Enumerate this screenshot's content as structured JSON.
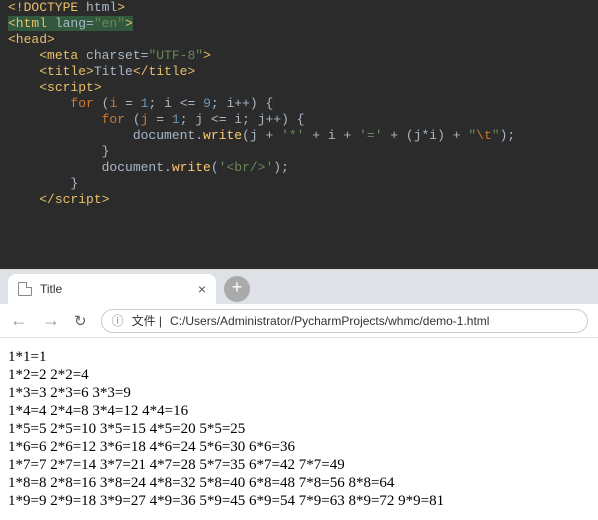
{
  "editor": {
    "lines": [
      [
        [
          "tag",
          "<!DOCTYPE "
        ],
        [
          "attr-name",
          "html"
        ],
        [
          "tag",
          ">"
        ]
      ],
      [
        [
          "html-highlight-open",
          ""
        ],
        [
          "tag",
          "<html "
        ],
        [
          "attr-name",
          "lang="
        ],
        [
          "attr-val",
          "\"en\""
        ],
        [
          "tag",
          ">"
        ],
        [
          "html-highlight-close",
          ""
        ]
      ],
      [
        [
          "tag",
          "<head>"
        ]
      ],
      [
        [
          "indent",
          "    "
        ],
        [
          "tag",
          "<meta "
        ],
        [
          "attr-name",
          "charset="
        ],
        [
          "attr-val",
          "\"UTF-8\""
        ],
        [
          "tag",
          ">"
        ]
      ],
      [
        [
          "indent",
          "    "
        ],
        [
          "tag",
          "<title>"
        ],
        [
          "punct",
          "Title"
        ],
        [
          "tag",
          "</title>"
        ]
      ],
      [
        [
          "indent",
          "    "
        ],
        [
          "tag",
          "<script>"
        ]
      ],
      [
        [
          "indent",
          "        "
        ],
        [
          "kw",
          "for "
        ],
        [
          "punct",
          "("
        ],
        [
          "kw",
          "i"
        ],
        [
          "punct",
          " = "
        ],
        [
          "num",
          "1"
        ],
        [
          "punct",
          "; i <= "
        ],
        [
          "num",
          "9"
        ],
        [
          "punct",
          "; i++) {"
        ]
      ],
      [
        [
          "indent",
          "            "
        ],
        [
          "kw",
          "for "
        ],
        [
          "punct",
          "("
        ],
        [
          "kw",
          "j"
        ],
        [
          "punct",
          " = "
        ],
        [
          "num",
          "1"
        ],
        [
          "punct",
          "; j <= i; j++) {"
        ]
      ],
      [
        [
          "indent",
          "                "
        ],
        [
          "punct",
          "document."
        ],
        [
          "fn",
          "write"
        ],
        [
          "punct",
          "(j + "
        ],
        [
          "str",
          "'*'"
        ],
        [
          "punct",
          " + i + "
        ],
        [
          "str",
          "'='"
        ],
        [
          "punct",
          " + (j*i) + "
        ],
        [
          "str",
          "\""
        ],
        [
          "escape",
          "\\t"
        ],
        [
          "str",
          "\""
        ],
        [
          "punct",
          ");"
        ]
      ],
      [
        [
          "indent",
          "            "
        ],
        [
          "punct",
          "}"
        ]
      ],
      [
        [
          "indent",
          "            "
        ],
        [
          "punct",
          "document."
        ],
        [
          "fn",
          "write"
        ],
        [
          "punct",
          "("
        ],
        [
          "str",
          "'<br/>'"
        ],
        [
          "punct",
          ");"
        ]
      ],
      [
        [
          "indent",
          "        "
        ],
        [
          "punct",
          "}"
        ]
      ],
      [
        [
          "indent",
          "    "
        ],
        [
          "tag",
          "</scr"
        ],
        [
          "tag",
          "ipt>"
        ]
      ]
    ]
  },
  "browser": {
    "tab_title": "Title",
    "close": "×",
    "plus": "+",
    "nav_back": "←",
    "nav_fwd": "→",
    "reload": "↻",
    "info_icon": "ⓘ",
    "url_prefix": "文件 |",
    "url_path": "C:/Users/Administrator/PycharmProjects/whmc/demo-1.html"
  },
  "chart_data": {
    "type": "table",
    "title": "Multiplication table (9×9)",
    "rows": [
      [
        {
          "j": 1,
          "i": 1,
          "v": 1
        }
      ],
      [
        {
          "j": 1,
          "i": 2,
          "v": 2
        },
        {
          "j": 2,
          "i": 2,
          "v": 4
        }
      ],
      [
        {
          "j": 1,
          "i": 3,
          "v": 3
        },
        {
          "j": 2,
          "i": 3,
          "v": 6
        },
        {
          "j": 3,
          "i": 3,
          "v": 9
        }
      ],
      [
        {
          "j": 1,
          "i": 4,
          "v": 4
        },
        {
          "j": 2,
          "i": 4,
          "v": 8
        },
        {
          "j": 3,
          "i": 4,
          "v": 12
        },
        {
          "j": 4,
          "i": 4,
          "v": 16
        }
      ],
      [
        {
          "j": 1,
          "i": 5,
          "v": 5
        },
        {
          "j": 2,
          "i": 5,
          "v": 10
        },
        {
          "j": 3,
          "i": 5,
          "v": 15
        },
        {
          "j": 4,
          "i": 5,
          "v": 20
        },
        {
          "j": 5,
          "i": 5,
          "v": 25
        }
      ],
      [
        {
          "j": 1,
          "i": 6,
          "v": 6
        },
        {
          "j": 2,
          "i": 6,
          "v": 12
        },
        {
          "j": 3,
          "i": 6,
          "v": 18
        },
        {
          "j": 4,
          "i": 6,
          "v": 24
        },
        {
          "j": 5,
          "i": 6,
          "v": 30
        },
        {
          "j": 6,
          "i": 6,
          "v": 36
        }
      ],
      [
        {
          "j": 1,
          "i": 7,
          "v": 7
        },
        {
          "j": 2,
          "i": 7,
          "v": 14
        },
        {
          "j": 3,
          "i": 7,
          "v": 21
        },
        {
          "j": 4,
          "i": 7,
          "v": 28
        },
        {
          "j": 5,
          "i": 7,
          "v": 35
        },
        {
          "j": 6,
          "i": 7,
          "v": 42
        },
        {
          "j": 7,
          "i": 7,
          "v": 49
        }
      ],
      [
        {
          "j": 1,
          "i": 8,
          "v": 8
        },
        {
          "j": 2,
          "i": 8,
          "v": 16
        },
        {
          "j": 3,
          "i": 8,
          "v": 24
        },
        {
          "j": 4,
          "i": 8,
          "v": 32
        },
        {
          "j": 5,
          "i": 8,
          "v": 40
        },
        {
          "j": 6,
          "i": 8,
          "v": 48
        },
        {
          "j": 7,
          "i": 8,
          "v": 56
        },
        {
          "j": 8,
          "i": 8,
          "v": 64
        }
      ],
      [
        {
          "j": 1,
          "i": 9,
          "v": 9
        },
        {
          "j": 2,
          "i": 9,
          "v": 18
        },
        {
          "j": 3,
          "i": 9,
          "v": 27
        },
        {
          "j": 4,
          "i": 9,
          "v": 36
        },
        {
          "j": 5,
          "i": 9,
          "v": 45
        },
        {
          "j": 6,
          "i": 9,
          "v": 54
        },
        {
          "j": 7,
          "i": 9,
          "v": 63
        },
        {
          "j": 8,
          "i": 9,
          "v": 72
        },
        {
          "j": 9,
          "i": 9,
          "v": 81
        }
      ]
    ]
  }
}
